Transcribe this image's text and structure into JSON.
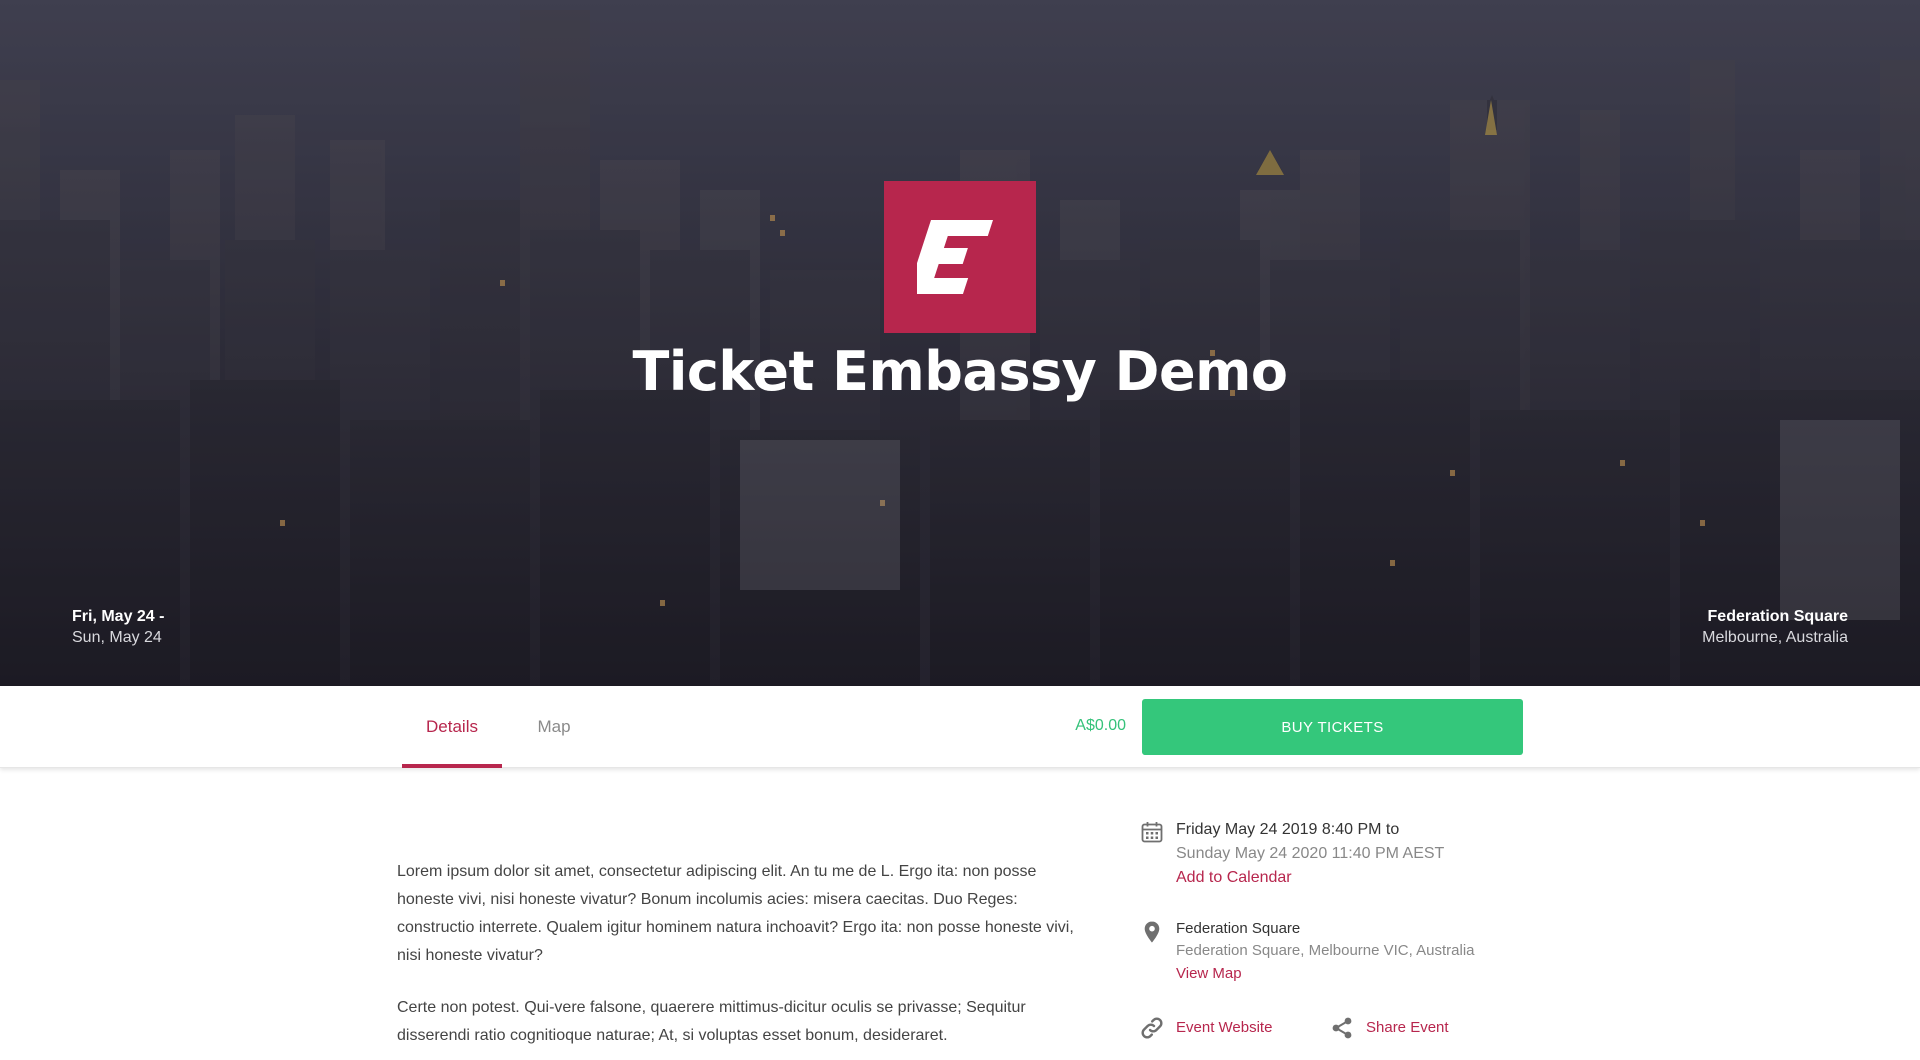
{
  "hero": {
    "title": "Ticket Embassy Demo",
    "logo_icon": "ticket-embassy-logo",
    "date_start": "Fri, May 24 -",
    "date_end": "Sun, May 24",
    "venue_name": "Federation Square",
    "venue_city": "Melbourne, Australia"
  },
  "tabs": [
    {
      "label": "Details",
      "active": true
    },
    {
      "label": "Map",
      "active": false
    }
  ],
  "purchase": {
    "price": "A$0.00",
    "buy_label": "BUY TICKETS"
  },
  "description": [
    "Lorem ipsum dolor sit amet, consectetur adipiscing elit. An tu me de L. Ergo ita: non posse honeste vivi, nisi honeste vivatur? Bonum incolumis acies: misera caecitas. Duo Reges: constructio interrete. Qualem igitur hominem natura inchoavit? Ergo ita: non posse honeste vivi, nisi honeste vivatur?",
    "Certe non potest. Qui-vere falsone, quaerere mittimus-dicitur oculis se privasse; Sequitur disserendi ratio cognitioque naturae; At, si voluptas esset bonum, desideraret."
  ],
  "event_info": {
    "datetime_line1": "Friday May 24 2019 8:40 PM to",
    "datetime_line2": "Sunday May 24 2020 11:40 PM AEST",
    "add_calendar": "Add to Calendar",
    "venue_name": "Federation Square",
    "venue_address": "Federation Square, Melbourne VIC, Australia",
    "view_map": "View Map",
    "website_label": "Event Website",
    "share_label": "Share Event"
  },
  "colors": {
    "brand": "#b7264d",
    "buy_green": "#34c77b",
    "price_green": "#35c27a",
    "icon_gray": "#6f6f6f"
  }
}
